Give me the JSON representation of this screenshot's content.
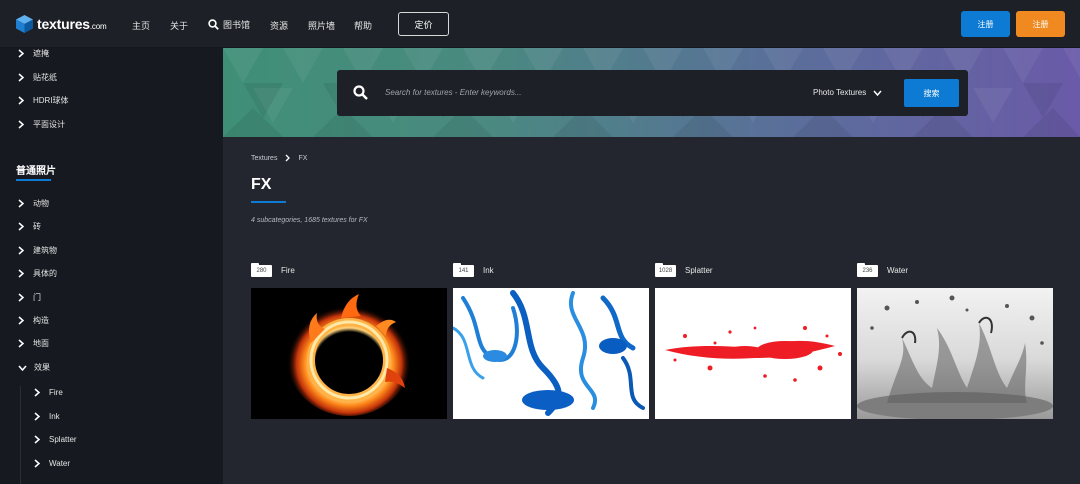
{
  "topnav": {
    "logo": {
      "name": "textures",
      "suffix": ".com"
    },
    "links": [
      "主页",
      "关于"
    ],
    "library_label": "图书馆",
    "links2": [
      "资源",
      "照片墙",
      "帮助"
    ],
    "pricing_label": "定价",
    "btn_blue_label": "注册",
    "btn_orange_label": "注册"
  },
  "sidebar": {
    "top_items": [
      "遮掩",
      "贴花纸",
      "HDRI球体",
      "平面设计"
    ],
    "heading": "普通照片",
    "items": [
      "动物",
      "砖",
      "建筑物",
      "具体的",
      "门",
      "构造",
      "地面",
      "效果"
    ],
    "sub_items": [
      "Fire",
      "Ink",
      "Splatter",
      "Water"
    ]
  },
  "search": {
    "placeholder": "Search for textures - Enter keywords...",
    "type_label": "Photo Textures",
    "button_label": "搜索"
  },
  "breadcrumb": [
    "Textures",
    "FX"
  ],
  "page": {
    "title": "FX",
    "subtitle": "4 subcategories, 1685 textures for FX"
  },
  "categories": [
    {
      "name": "Fire",
      "count": "280"
    },
    {
      "name": "Ink",
      "count": "141"
    },
    {
      "name": "Splatter",
      "count": "1028"
    },
    {
      "name": "Water",
      "count": "236"
    }
  ],
  "colors": {
    "accent_blue": "#0d7bd4",
    "accent_orange": "#f0891f",
    "sidebar_bg": "#161a20",
    "page_bg": "#23262e"
  }
}
